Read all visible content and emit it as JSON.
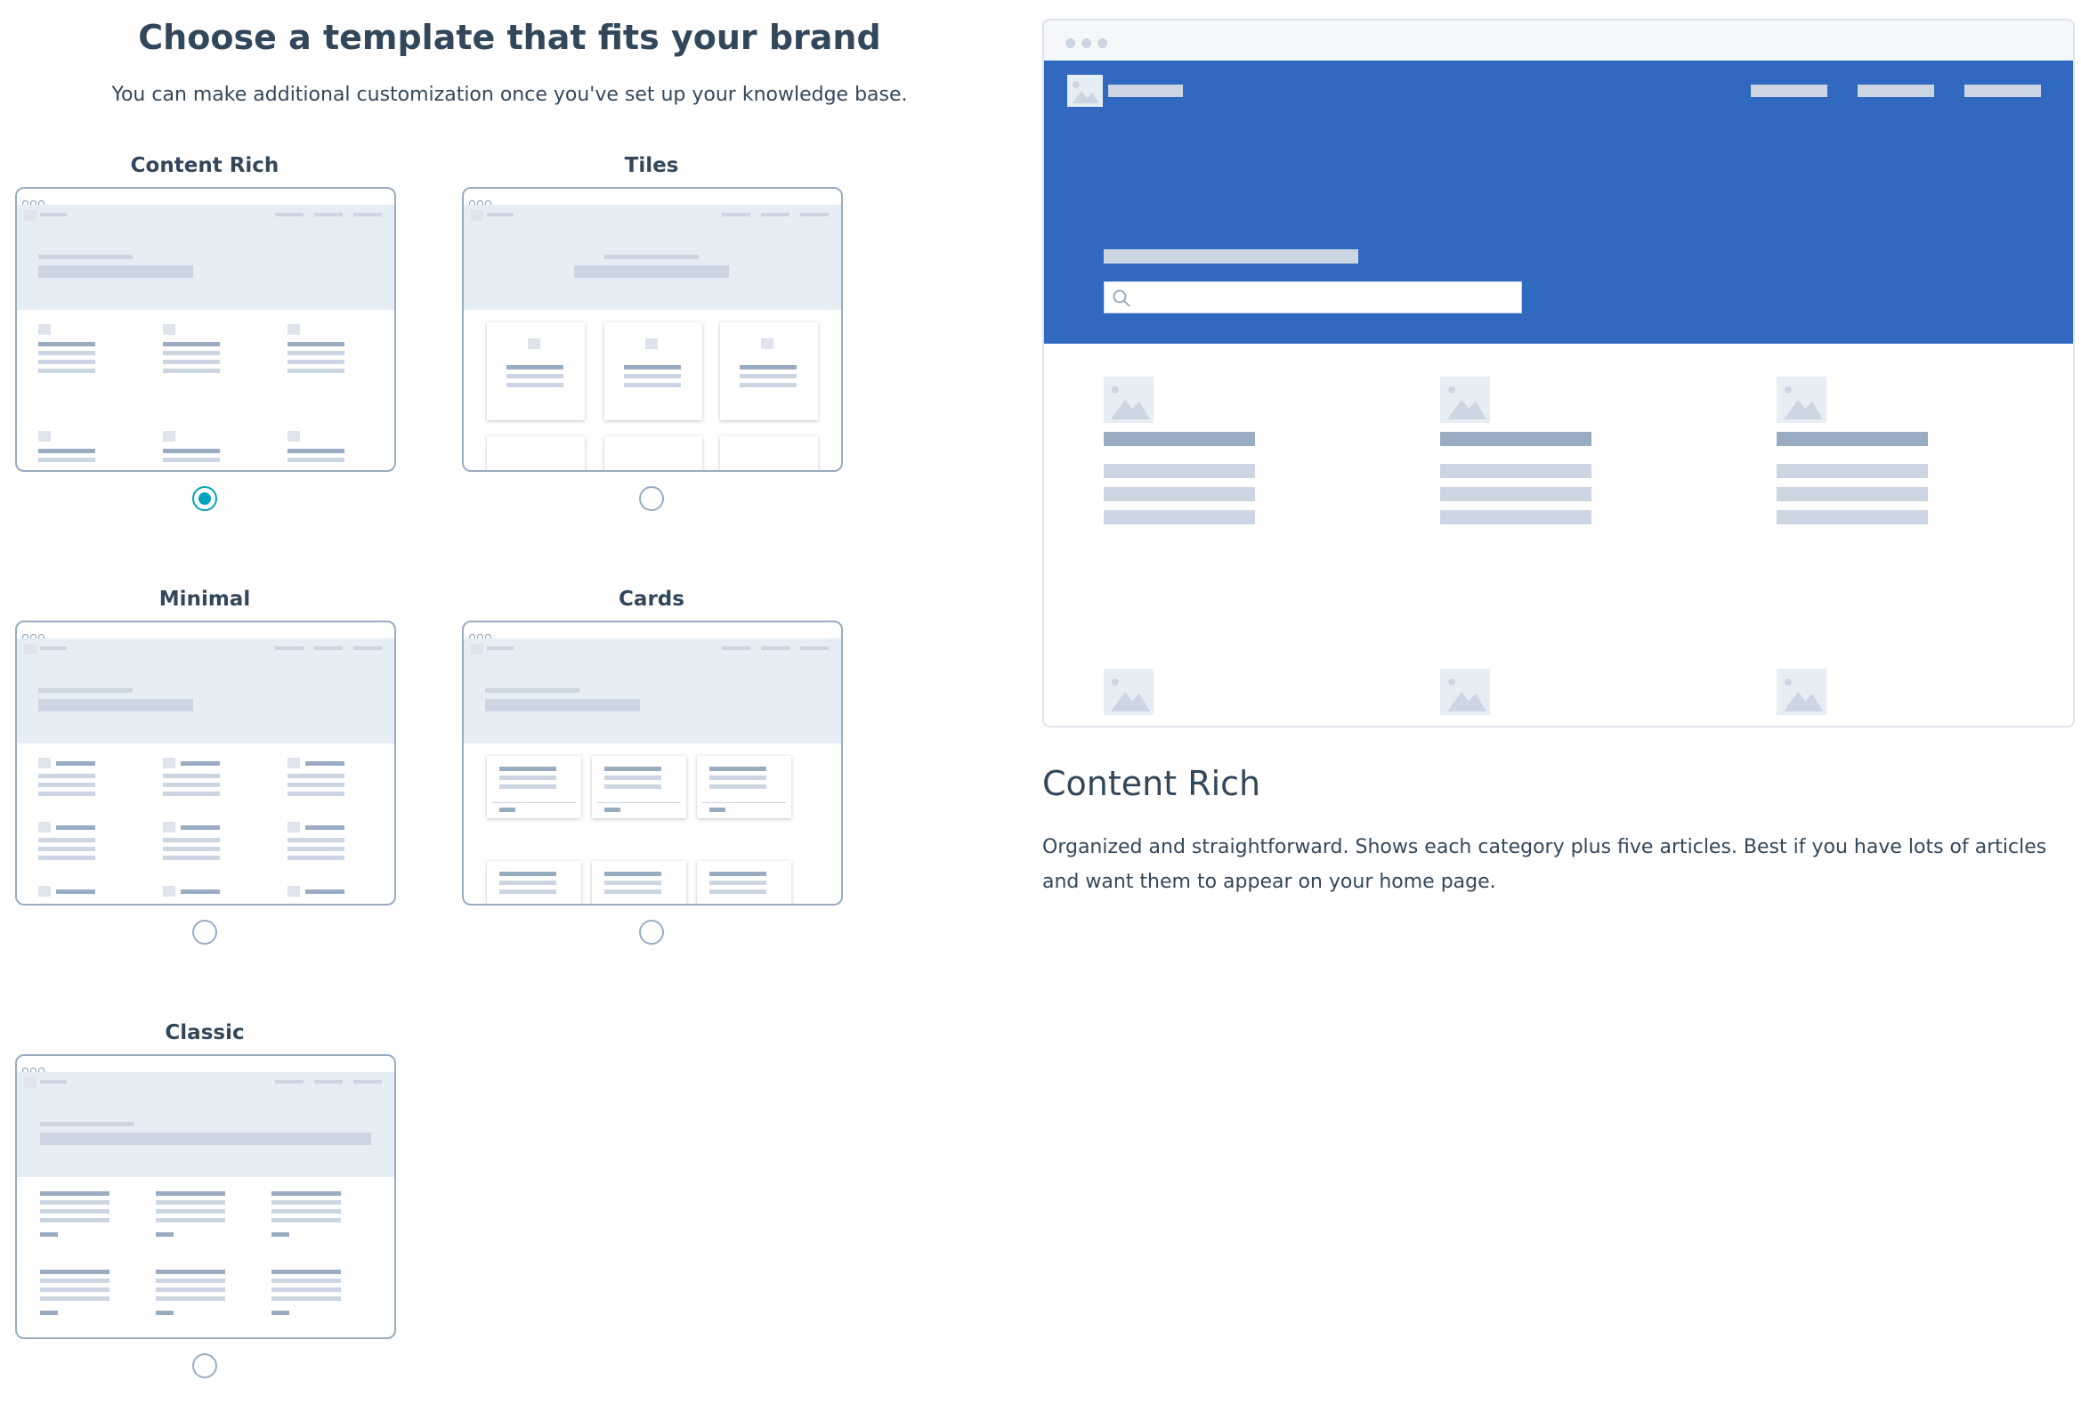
{
  "header": {
    "title": "Choose a template that fits your brand",
    "subtitle": "You can make additional customization once you've set up your knowledge base."
  },
  "templates": [
    {
      "label": "Content Rich",
      "selected": true
    },
    {
      "label": "Tiles",
      "selected": false
    },
    {
      "label": "Minimal",
      "selected": false
    },
    {
      "label": "Cards",
      "selected": false
    },
    {
      "label": "Classic",
      "selected": false
    }
  ],
  "preview": {
    "title": "Content Rich",
    "description": "Organized and straightforward. Shows each category plus five articles. Best if you have lots of articles and want them to appear on your home page.",
    "hero_color": "#3169c1",
    "accent_color": "#00a4bd"
  },
  "icons": {
    "search": "magnifier",
    "image_placeholder": "mountain-image"
  }
}
